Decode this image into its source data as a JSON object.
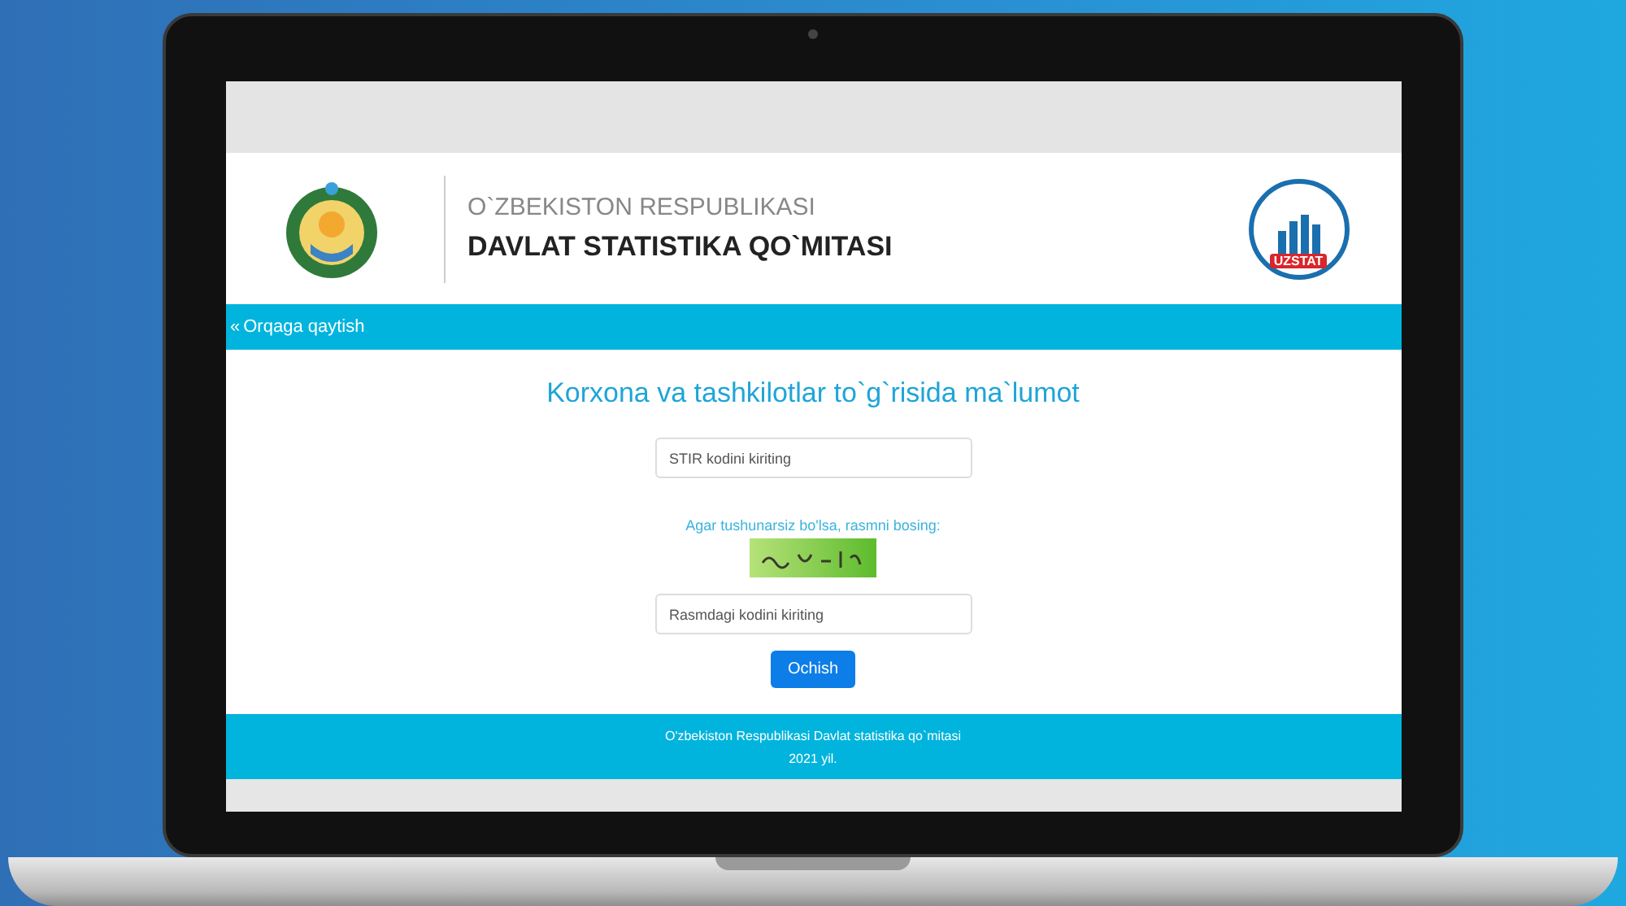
{
  "header": {
    "subtitle": "O`ZBEKISTON RESPUBLIKASI",
    "title": "DAVLAT STATISTIKA QO`MITASI",
    "logo_text": "UZSTAT"
  },
  "nav": {
    "back_icon": "«",
    "back_label": "Orqaga qaytish"
  },
  "form": {
    "heading": "Korxona va tashkilotlar to`g`risida ma`lumot",
    "stir_field": {
      "placeholder": "STIR kodini kiriting"
    },
    "captcha_hint": "Agar tushunarsiz bo'lsa, rasmni bosing:",
    "captcha_field": {
      "placeholder": "Rasmdagi kodini kiriting"
    },
    "submit": "Ochish"
  },
  "footer": {
    "line_1": "O'zbekiston Respublikasi Davlat statistika qo`mitasi",
    "line_2": "2021 yil."
  }
}
